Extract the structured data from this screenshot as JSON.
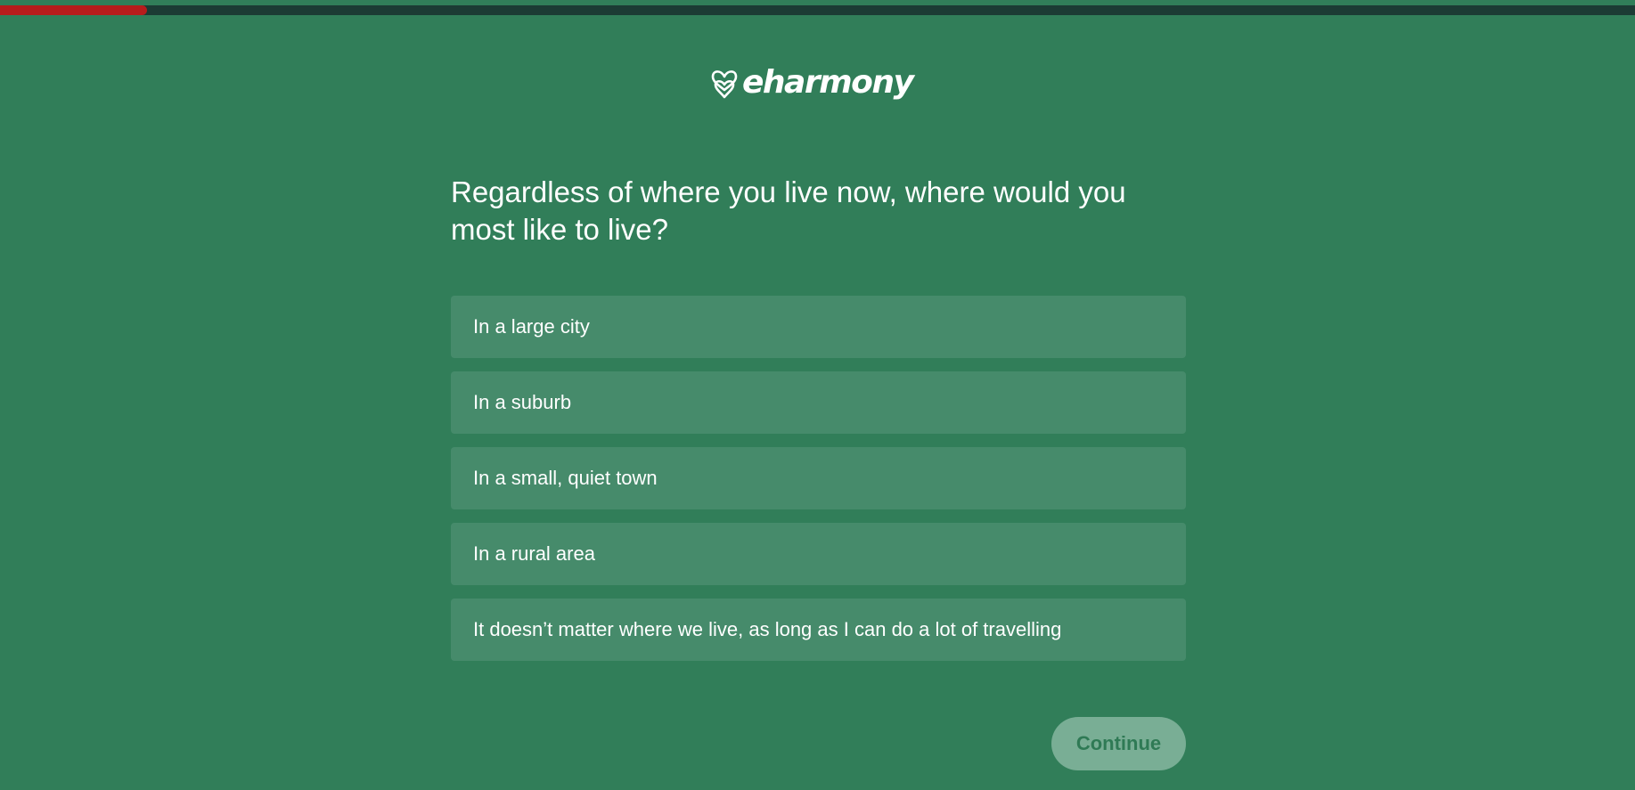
{
  "progress": {
    "value_percent": 9,
    "fill_color": "#b71c1c",
    "track_color": "#1c3b34"
  },
  "brand": {
    "name": "eharmony",
    "icon": "double-heart-icon"
  },
  "question": {
    "text": "Regardless of where you live now, where would you most like to live?"
  },
  "options": [
    {
      "label": "In a large city"
    },
    {
      "label": "In a suburb"
    },
    {
      "label": "In a small, quiet town"
    },
    {
      "label": "In a rural area"
    },
    {
      "label": "It doesn’t matter where we live, as long as I can do a lot of travelling"
    }
  ],
  "continue": {
    "label": "Continue",
    "state": "disabled"
  },
  "colors": {
    "background": "#317e59",
    "option_bg": "#468b6b",
    "button_bg": "#79ae95",
    "button_text": "#2f7a55"
  }
}
